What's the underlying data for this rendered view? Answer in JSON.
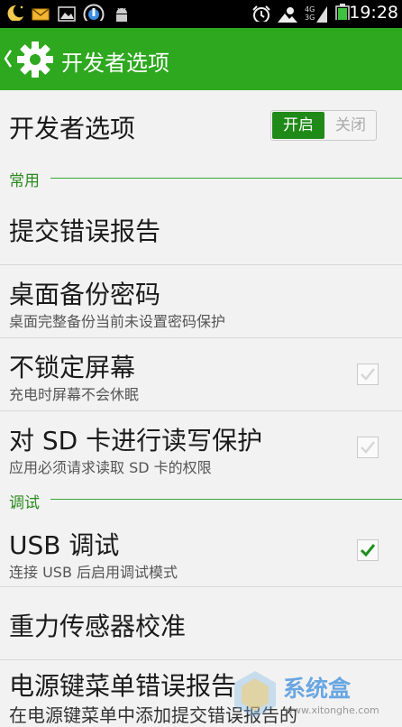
{
  "status_bar": {
    "time": "19:28",
    "signal_4g": "4G",
    "signal_3g": "3G",
    "icons": [
      "moon-icon",
      "mail-icon",
      "image-icon",
      "fastboot-icon",
      "android-icon",
      "alarm-icon",
      "weather-icon",
      "signal-icon",
      "battery-icon"
    ]
  },
  "action_bar": {
    "title": "开发者选项",
    "color": "#2ea81f"
  },
  "master_toggle": {
    "label": "开发者选项",
    "on_label": "开启",
    "off_label": "关闭",
    "state": "on"
  },
  "sections": {
    "general": "常用",
    "debug": "调试"
  },
  "items": [
    {
      "title": "提交错误报告",
      "subtitle": ""
    },
    {
      "title": "桌面备份密码",
      "subtitle": "桌面完整备份当前未设置密码保护"
    },
    {
      "title": "不锁定屏幕",
      "subtitle": "充电时屏幕不会休眠",
      "checked": false
    },
    {
      "title": "对 SD 卡进行读写保护",
      "subtitle": "应用必须请求读取 SD 卡的权限",
      "checked": false
    },
    {
      "title": "USB 调试",
      "subtitle": "连接 USB 后启用调试模式",
      "checked": true
    },
    {
      "title": "重力传感器校准",
      "subtitle": ""
    },
    {
      "title": "电源键菜单错误报告",
      "subtitle": "在电源键菜单中添加提交错误报告的"
    }
  ],
  "watermark": {
    "brand": "系统盒",
    "url": "www.xitonghe.com"
  }
}
